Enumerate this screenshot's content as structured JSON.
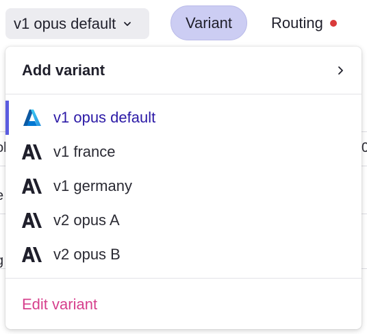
{
  "toolbar": {
    "variant_select_value": "v1 opus default",
    "tabs": [
      {
        "label": "Variant",
        "active": true
      },
      {
        "label": "Routing",
        "indicator": "red-dot"
      }
    ]
  },
  "background_fragments": [
    "ol",
    "0",
    "e",
    "g"
  ],
  "dropdown": {
    "add_variant_label": "Add variant",
    "items": [
      {
        "label": "v1 opus default",
        "icon": "azure-logo-icon",
        "selected": true
      },
      {
        "label": "v1 france",
        "icon": "anthropic-logo-icon",
        "selected": false
      },
      {
        "label": "v1 germany",
        "icon": "anthropic-logo-icon",
        "selected": false
      },
      {
        "label": "v2 opus A",
        "icon": "anthropic-logo-icon",
        "selected": false
      },
      {
        "label": "v2 opus B",
        "icon": "anthropic-logo-icon",
        "selected": false
      }
    ],
    "edit_variant_label": "Edit variant"
  },
  "colors": {
    "accent": "#5a5ce0",
    "selected_text": "#2b19a6",
    "edit_link": "#d63f8c",
    "active_tab_bg": "#cccdf3",
    "status_dot": "#d93a3a"
  }
}
